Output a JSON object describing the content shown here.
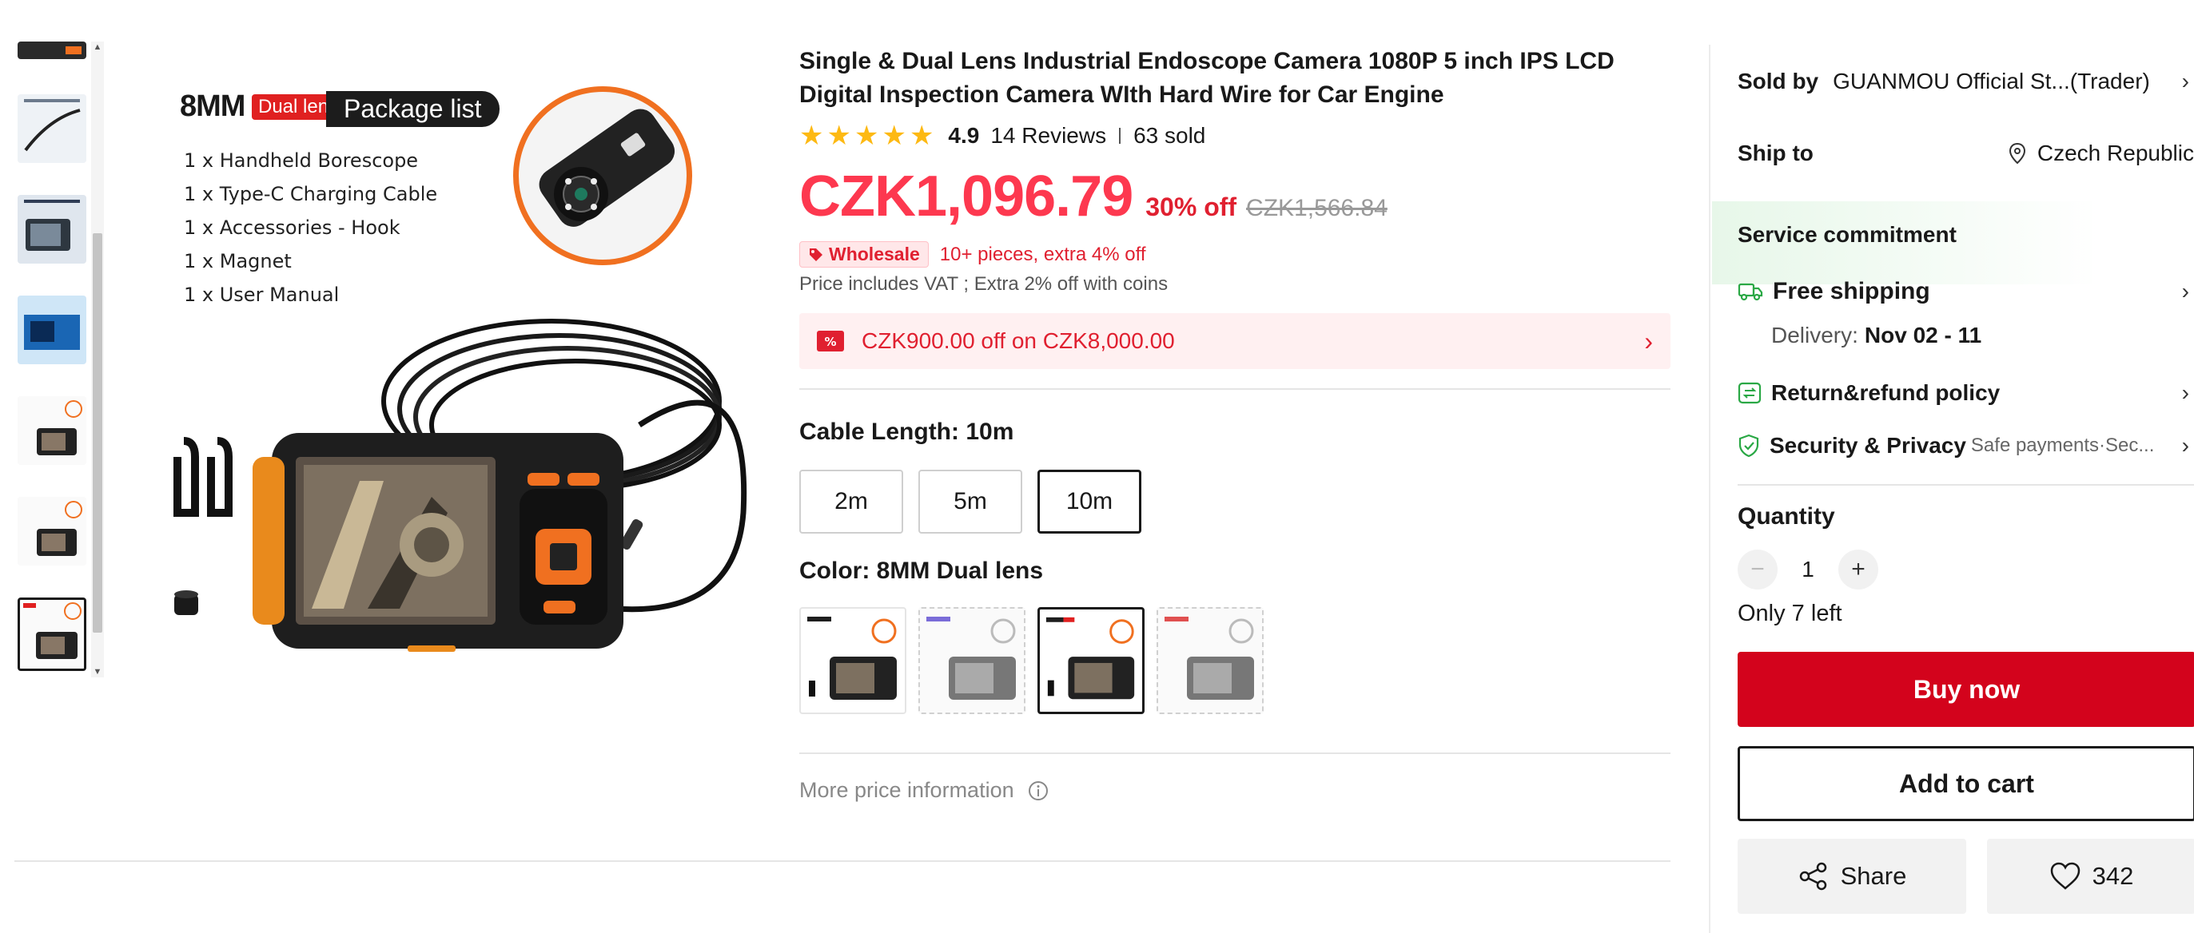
{
  "gallery": {
    "thumbnail_count": 8,
    "active_index": 6,
    "image_text": {
      "size_label": "8MM",
      "lens_badge": "Dual lens",
      "package_title": "Package list",
      "package_items": [
        "1 x  Handheld Borescope",
        "1 x  Type-C Charging Cable",
        "1 x  Accessories - Hook",
        "1 x  Magnet",
        "1 x  User Manual"
      ]
    }
  },
  "product": {
    "title": "Single & Dual Lens Industrial Endoscope Camera 1080P 5 inch IPS LCD Digital Inspection Camera WIth Hard Wire for Car Engine",
    "rating": "4.9",
    "stars": 5,
    "reviews": "14 Reviews",
    "sold": "63 sold",
    "price": "CZK1,096.79",
    "discount": "30% off",
    "original_price": "CZK1,566.84",
    "wholesale_badge": "Wholesale",
    "wholesale_text": "10+ pieces, extra 4% off",
    "vat_note": "Price includes VAT ; Extra 2% off with coins",
    "coupon": "CZK900.00 off on CZK8,000.00",
    "cable_length_label": "Cable Length: 10m",
    "cable_options": [
      "2m",
      "5m",
      "10m"
    ],
    "cable_selected": "10m",
    "color_label": "Color: 8MM Dual lens",
    "color_swatch_count": 4,
    "color_selected_index": 2,
    "more_price_info": "More price information"
  },
  "panel": {
    "sold_by_label": "Sold by",
    "seller": "GUANMOU Official St...(Trader)",
    "ship_to_label": "Ship to",
    "ship_to": "Czech Republic",
    "service_title": "Service commitment",
    "free_shipping": "Free shipping",
    "delivery_label": "Delivery:",
    "delivery_dates": "Nov 02 - 11",
    "return_policy": "Return&refund policy",
    "security_label": "Security & Privacy",
    "security_detail": "Safe payments·Sec...",
    "quantity_label": "Quantity",
    "quantity": "1",
    "stock": "Only 7 left",
    "buy_now": "Buy now",
    "add_to_cart": "Add to cart",
    "share": "Share",
    "wishlist_count": "342"
  },
  "colors": {
    "price_red": "#fd384f",
    "buy_red": "#d3031c",
    "star_yellow": "#fdb913",
    "accent_orange": "#f07020",
    "green": "#2aa845"
  }
}
